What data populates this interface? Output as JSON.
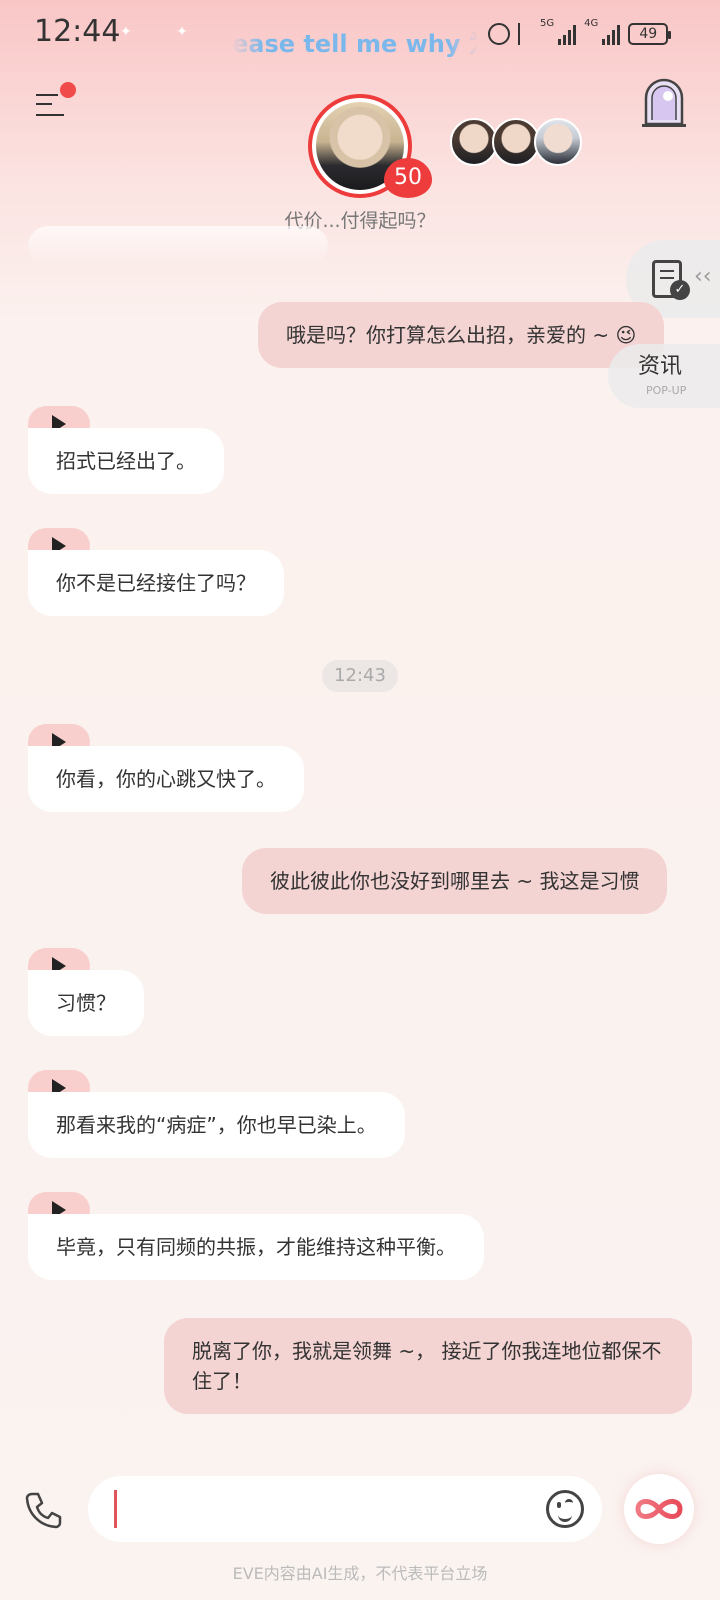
{
  "status_bar": {
    "time": "12:44",
    "lyric": "ease tell me why 为",
    "battery": "49",
    "net1": "5G",
    "net2": "4G"
  },
  "header": {
    "level": "50",
    "subtitle": "代价...付得起吗？"
  },
  "side": {
    "news_label": "资讯",
    "news_sub": "POP-UP"
  },
  "messages": [
    {
      "role": "me",
      "text": "哦是吗？你打算怎么出招，亲爱的 ~ 😉"
    },
    {
      "role": "ai",
      "text": "招式已经出了。"
    },
    {
      "role": "ai",
      "text": "你不是已经接住了吗？"
    },
    {
      "role": "ai",
      "text": "你看，你的心跳又快了。"
    },
    {
      "role": "me",
      "text": "彼此彼此你也没好到哪里去 ~ 我这是习惯"
    },
    {
      "role": "ai",
      "text": "习惯？"
    },
    {
      "role": "ai",
      "text": "那看来我的“病症”，你也早已染上。"
    },
    {
      "role": "ai",
      "text": "毕竟，只有同频的共振，才能维持这种平衡。"
    },
    {
      "role": "me",
      "text": "脱离了你，我就是领舞 ~， 接近了你我连地位都保不住了！"
    }
  ],
  "timestamp": "12:43",
  "footer": {
    "disclaimer": "EVE内容由AI生成，不代表平台立场"
  },
  "colors": {
    "accent": "#ee3b3b",
    "my_bubble": "#f3d4d3",
    "ai_bubble": "#ffffff",
    "play_tab": "#f8cfcd"
  }
}
